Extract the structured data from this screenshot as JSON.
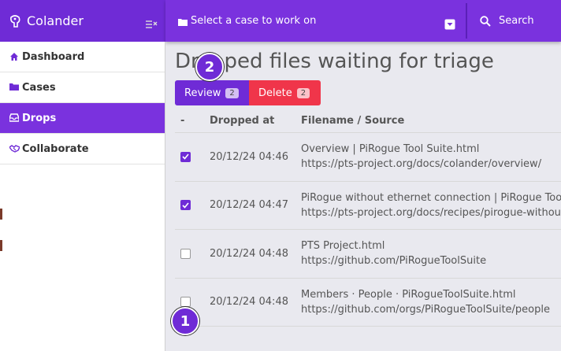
{
  "brand": {
    "title": "Colander",
    "logo_icon": "colander-logo-icon",
    "collapse_icon": "collapse-sidebar-icon"
  },
  "topbar": {
    "case_select": {
      "label": "Select a case to work on",
      "icon": "folder-icon",
      "caret": "dropdown-caret-icon"
    },
    "search": {
      "placeholder": "Search",
      "icon": "search-icon"
    }
  },
  "sidebar": {
    "items": [
      {
        "label": "Dashboard",
        "icon": "home-icon",
        "active": false
      },
      {
        "label": "Cases",
        "icon": "folder-icon",
        "active": false
      },
      {
        "label": "Drops",
        "icon": "inbox-icon",
        "active": true
      },
      {
        "label": "Collaborate",
        "icon": "handshake-icon",
        "active": false
      }
    ]
  },
  "main": {
    "title": "Dropped files waiting for triage",
    "actions": {
      "review": {
        "label": "Review",
        "count": "2"
      },
      "delete": {
        "label": "Delete",
        "count": "2"
      }
    },
    "table": {
      "headers": {
        "select": "-",
        "dropped_at": "Dropped at",
        "filename": "Filename / Source"
      },
      "rows": [
        {
          "checked": true,
          "dropped_at": "20/12/24 04:46",
          "filename": "Overview | PiRogue Tool Suite.html",
          "source": "https://pts-project.org/docs/colander/overview/"
        },
        {
          "checked": true,
          "dropped_at": "20/12/24 04:47",
          "filename": "PiRogue without ethernet connection | PiRogue Tool Suite.html",
          "source": "https://pts-project.org/docs/recipes/pirogue-without-ethernet/"
        },
        {
          "checked": false,
          "dropped_at": "20/12/24 04:48",
          "filename": "PTS Project.html",
          "source": "https://github.com/PiRogueToolSuite"
        },
        {
          "checked": false,
          "dropped_at": "20/12/24 04:48",
          "filename": "Members · People · PiRogueToolSuite.html",
          "source": "https://github.com/orgs/PiRogueToolSuite/people"
        }
      ]
    }
  },
  "annotations": [
    {
      "label": "1"
    },
    {
      "label": "2"
    }
  ],
  "colors": {
    "primary": "#6f2bd6",
    "topbar": "#7a32de",
    "danger": "#f0354a"
  }
}
